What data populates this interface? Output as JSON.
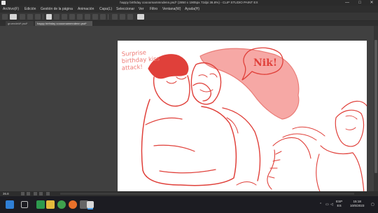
{
  "window": {
    "title": "happy birthday coooomammndenn.psd* (2850 x 1905px 72dpi 36.8%)  - CLIP STUDIO PAINT EX",
    "controls": [
      "—",
      "□",
      "✕"
    ]
  },
  "menu": [
    "Archivo(F)",
    "Edición",
    "Gestión de la página",
    "Animación",
    "Capa(L)",
    "Seleccionar",
    "Ver",
    "Filtro",
    "Ventana(W)",
    "Ayuda(H)"
  ],
  "tabs": [
    {
      "label": "gruendeld*.psd*"
    },
    {
      "label": "happy birthday coooomammndenn.psd*"
    }
  ],
  "canvas": {
    "note_text": "Surprise birthday kiss attack!",
    "bubble_text": "Nik!",
    "ink_color": "#e0403a"
  },
  "statusbar": {
    "zoom": "36.8"
  },
  "taskbar": {
    "language": "ESP",
    "region": "ES",
    "time": "15:18",
    "date": "10/6/2023"
  },
  "colors": {
    "ink": "#e0403a",
    "chrome": "#2e2e2e",
    "workspace": "#404040"
  }
}
